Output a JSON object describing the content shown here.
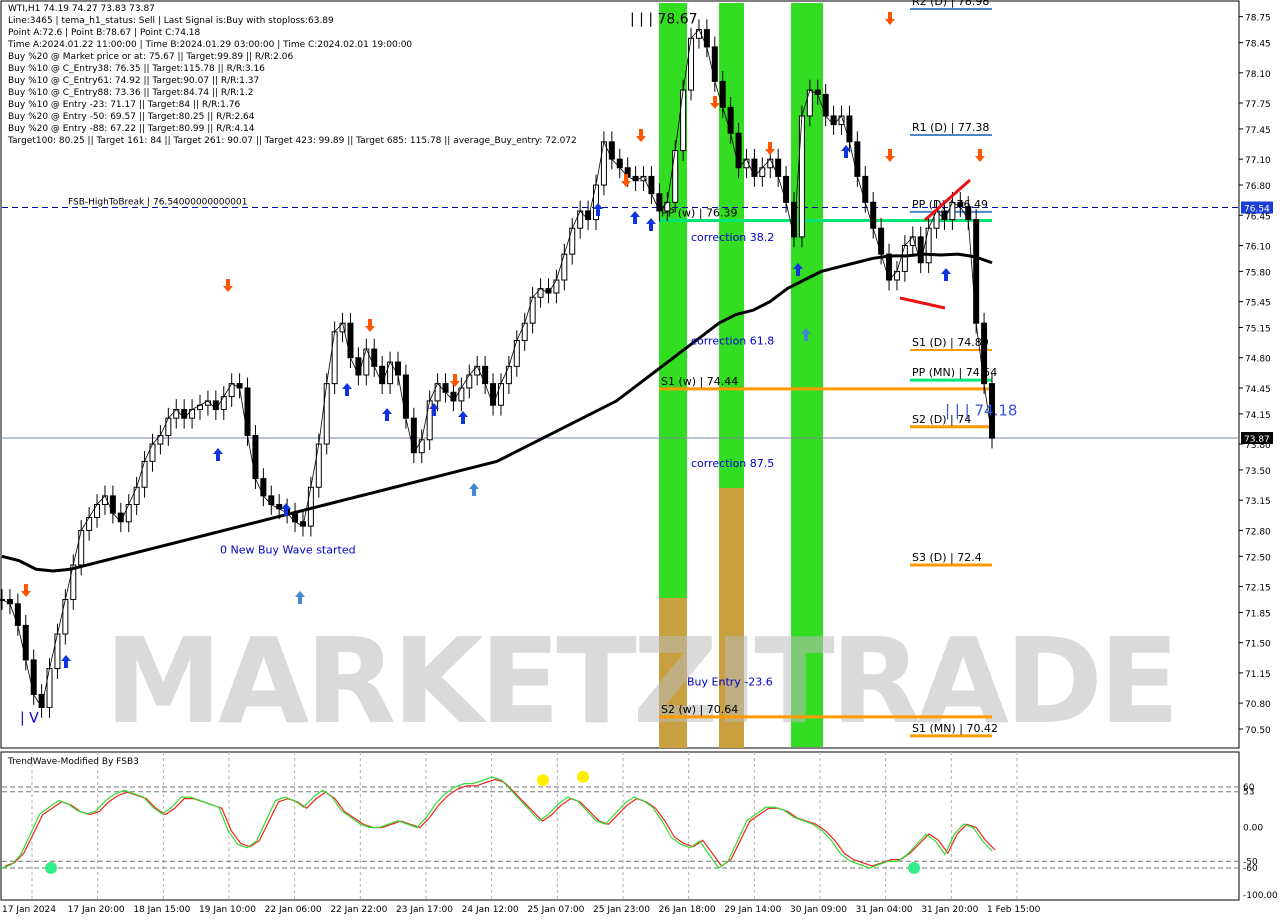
{
  "info": {
    "symbol_line": "WTI,H1  74.19 74.27 73.83 73.87",
    "lines": [
      "Line:3465 | tema_h1_status: Sell | Last Signal is:Buy with stoploss:63.89",
      "Point A:72.6 | Point B:78.67 | Point C:74.18",
      "Time A:2024.01.22 11:00:00 | Time B:2024.01.29 03:00:00 | Time C:2024.02.01 19:00:00",
      "Buy %20 @ Market price or at: 75.67 || Target:99.89 || R/R:2.06",
      "Buy %10 @ C_Entry38: 76.35 || Target:115.78 || R/R:3.16",
      "Buy %10 @ C_Entry61: 74.92 || Target:90.07 || R/R:1.37",
      "Buy %10 @ C_Entry88: 73.36 || Target:84.74 || R/R:1.2",
      "Buy %10 @ Entry -23: 71.17 || Target:84 || R/R:1.76",
      "Buy %20 @ Entry -50: 69.57 || Target:80.25 || R/R:2.64",
      "Buy %20 @ Entry -88: 67.22 || Target:80.99 || R/R:4.14",
      "Target100: 80.25 || Target 161: 84 || Target 261: 90.07 || Target 423: 99.89 || Target 685: 115.78 || average_Buy_entry: 72.072"
    ]
  },
  "chart_data": {
    "type": "line",
    "title": "WTI,H1",
    "ylim": [
      70.28,
      78.92
    ],
    "current_price": "73.87",
    "y_ticks": [
      "78.75",
      "78.45",
      "78.10",
      "77.75",
      "77.45",
      "77.10",
      "76.80",
      "76.45",
      "76.10",
      "75.80",
      "75.45",
      "75.15",
      "74.80",
      "74.45",
      "74.15",
      "73.80",
      "73.50",
      "73.15",
      "72.80",
      "72.50",
      "72.15",
      "71.85",
      "71.50",
      "71.15",
      "70.80",
      "70.50"
    ],
    "x_labels": [
      "17 Jan 2024",
      "17 Jan 20:00",
      "18 Jan 15:00",
      "19 Jan 10:00",
      "22 Jan 06:00",
      "22 Jan 22:00",
      "23 Jan 17:00",
      "24 Jan 12:00",
      "25 Jan 07:00",
      "25 Jan 23:00",
      "26 Jan 18:00",
      "29 Jan 14:00",
      "30 Jan 09:00",
      "31 Jan 04:00",
      "31 Jan 20:00",
      "1 Feb 15:00"
    ],
    "hlines": [
      {
        "label": "R2 (D) | 78.98",
        "value": 78.98,
        "color": "#4a86c8"
      },
      {
        "label": "R1 (D) | 77.38",
        "value": 77.38,
        "color": "#4a86c8"
      },
      {
        "label": "PP (D) | 76.49",
        "value": 76.49,
        "color": "#4a86c8"
      },
      {
        "label": "S1 (D) | 74.89",
        "value": 74.89,
        "color": "#ff9900"
      },
      {
        "label": "PP (MN) | 74.54",
        "value": 74.54,
        "color": "#00e676"
      },
      {
        "label": "S2 (D) | 74",
        "value": 74.0,
        "color": "#ff9900"
      },
      {
        "label": "S3 (D) | 72.4",
        "value": 72.4,
        "color": "#ff9900"
      },
      {
        "label": "S1 (MN) | 70.42",
        "value": 70.42,
        "color": "#ff9900"
      },
      {
        "label": "PP (w) | 76.39",
        "value": 76.39,
        "color": "#00e676"
      },
      {
        "label": "S1 (w) | 74.44",
        "value": 74.44,
        "color": "#ff9900"
      },
      {
        "label": "S2 (w) | 70.64",
        "value": 70.64,
        "color": "#ff9900"
      }
    ],
    "fsb_line": {
      "label": "FSB-HighToBreak | 76.54000000000001",
      "value": 76.54,
      "tag": "76.54"
    },
    "annotations": [
      {
        "text": "correction 38.2",
        "value": 76.2
      },
      {
        "text": "correction 61.8",
        "value": 75.0
      },
      {
        "text": "correction 87.5",
        "value": 73.58
      },
      {
        "text": "Buy Entry -23.6",
        "value": 71.05
      },
      {
        "text": "0 New Buy Wave started",
        "value": 72.58
      },
      {
        "text": "| | | 78.67",
        "value": 78.72
      },
      {
        "text": "| | | 74.18",
        "value": 74.18
      },
      {
        "text": "| V",
        "value": 70.62
      }
    ],
    "series": [
      {
        "name": "WTI,H1",
        "values": [
          72.0,
          71.95,
          71.7,
          71.3,
          70.9,
          70.75,
          71.2,
          71.6,
          72.0,
          72.4,
          72.8,
          72.95,
          73.1,
          73.2,
          73.0,
          72.9,
          73.1,
          73.3,
          73.6,
          73.8,
          73.9,
          74.1,
          74.2,
          74.1,
          74.2,
          74.25,
          74.3,
          74.2,
          74.35,
          74.5,
          74.45,
          73.9,
          73.4,
          73.2,
          73.1,
          73.05,
          73.0,
          72.9,
          72.85,
          73.3,
          73.8,
          74.5,
          75.1,
          75.2,
          74.8,
          74.6,
          74.9,
          74.7,
          74.5,
          74.75,
          74.6,
          74.1,
          73.7,
          73.85,
          74.3,
          74.5,
          74.4,
          74.3,
          74.45,
          74.6,
          74.7,
          74.5,
          74.25,
          74.5,
          74.7,
          75.0,
          75.2,
          75.5,
          75.6,
          75.55,
          75.7,
          76.0,
          76.3,
          76.5,
          76.4,
          76.8,
          77.3,
          77.1,
          77.0,
          76.9,
          76.85,
          76.9,
          76.7,
          76.5,
          76.6,
          77.2,
          77.9,
          78.5,
          78.6,
          78.4,
          78.0,
          77.7,
          77.4,
          77.0,
          77.1,
          76.9,
          77.0,
          77.1,
          76.9,
          76.6,
          76.2,
          77.6,
          77.9,
          77.85,
          77.6,
          77.5,
          77.6,
          77.3,
          76.9,
          76.6,
          76.3,
          76.0,
          75.7,
          75.8,
          76.1,
          76.2,
          75.9,
          76.3,
          76.5,
          76.4,
          76.6,
          76.55,
          76.4,
          75.2,
          74.5,
          73.87
        ]
      },
      {
        "name": "moving average",
        "values": [
          72.5,
          72.45,
          72.35,
          72.33,
          72.35,
          72.4,
          72.45,
          72.5,
          72.55,
          72.6,
          72.65,
          72.7,
          72.75,
          72.8,
          72.85,
          72.9,
          72.95,
          73.0,
          73.05,
          73.1,
          73.15,
          73.2,
          73.25,
          73.3,
          73.35,
          73.4,
          73.45,
          73.5,
          73.55,
          73.6,
          73.7,
          73.8,
          73.9,
          74.0,
          74.1,
          74.2,
          74.3,
          74.45,
          74.6,
          74.75,
          74.9,
          75.05,
          75.2,
          75.3,
          75.35,
          75.45,
          75.6,
          75.7,
          75.8,
          75.85,
          75.9,
          75.95,
          75.98,
          75.98,
          76.0,
          75.99,
          76.0,
          75.97,
          75.9
        ]
      },
      {
        "name": "TrendWave-Modified By FSB3",
        "values": [
          -60,
          -55,
          -40,
          -10,
          20,
          30,
          40,
          35,
          25,
          20,
          25,
          40,
          50,
          55,
          50,
          45,
          30,
          20,
          30,
          45,
          45,
          40,
          35,
          30,
          -5,
          -25,
          -30,
          -20,
          10,
          40,
          45,
          40,
          30,
          45,
          55,
          45,
          25,
          15,
          5,
          0,
          0,
          5,
          10,
          5,
          0,
          15,
          35,
          50,
          60,
          65,
          65,
          70,
          75,
          70,
          55,
          40,
          25,
          10,
          20,
          35,
          45,
          40,
          25,
          10,
          5,
          20,
          35,
          45,
          40,
          30,
          10,
          -15,
          -25,
          -30,
          -20,
          -40,
          -60,
          -50,
          -20,
          10,
          20,
          30,
          30,
          25,
          15,
          10,
          5,
          -5,
          -20,
          -40,
          -50,
          -55,
          -60,
          -55,
          -50,
          -50,
          -40,
          -25,
          -10,
          -20,
          -40,
          -10,
          5,
          0,
          -20,
          -35
        ]
      }
    ],
    "oscillator": {
      "label": "TrendWave-Modified By FSB3",
      "ylim": [
        -100,
        100
      ],
      "ticks": [
        "60",
        "53",
        "0.00",
        "-50",
        "-60",
        "-100.00"
      ],
      "levels": [
        60,
        53,
        -50,
        -60
      ]
    },
    "zones": [
      {
        "color": "#33dd22"
      },
      {
        "color": "#33dd22"
      },
      {
        "color": "#33dd22"
      }
    ]
  },
  "watermark": "MARKETZITRADE",
  "colors": {
    "up": "#000000",
    "red": "#dd2200",
    "blue": "#0000cc",
    "orange": "#ff8c00",
    "green": "#00e676",
    "magenta": "#ff00ff"
  }
}
